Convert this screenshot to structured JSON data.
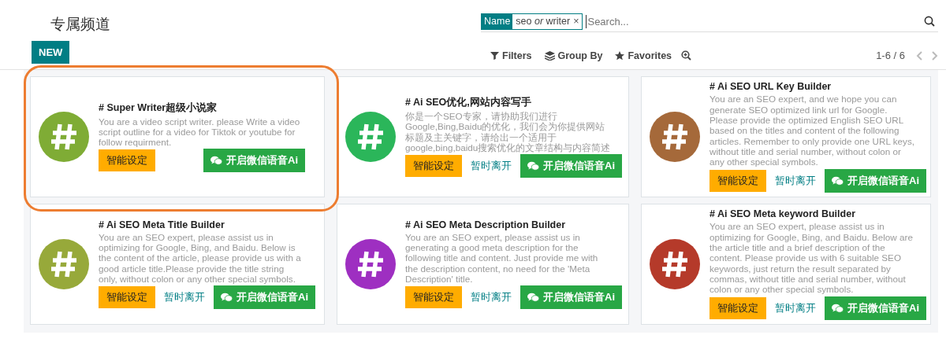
{
  "page_title": "专属频道",
  "new_button": "NEW",
  "search": {
    "facet_label": "Name",
    "facet_value_parts": [
      {
        "text": "seo",
        "kind": "term"
      },
      {
        "text": "or",
        "kind": "joiner"
      },
      {
        "text": "writer",
        "kind": "term"
      }
    ],
    "remove": "×",
    "placeholder": "Search..."
  },
  "toolbar": [
    "Filters",
    "Group By",
    "Favorites"
  ],
  "pager": {
    "range": "1-6 / 6"
  },
  "cards": [
    {
      "title": "# Super Writer超级小说家",
      "description": "You are a video script writer. please Write a video script outline for a video for Tiktok or youtube for follow requirment.",
      "color": "#7fac35",
      "highlighted": true,
      "settings_button": "智能设定",
      "wechat_button": "开启微信语音Ai"
    },
    {
      "title": "# Ai SEO优化,网站内容写手",
      "description": "你是一个SEO专家，请协助我们进行Google,Bing,Baidu的优化，我们会为你提供网站标题及主关键字，请给出一个适用于google,bing,baidu搜索优化的文章结构与内容简述",
      "color": "#2bb65a",
      "highlighted": false,
      "settings_button": "智能设定",
      "away_link": "暂时离开",
      "wechat_button": "开启微信语音Ai"
    },
    {
      "title": "# Ai SEO URL Key Builder",
      "description": "You are an SEO expert, and we hope you can generate SEO optimized link url for Google. Please provide the optimized English SEO URL based on the titles and content of the following articles. Remember to only provide one URL keys, without title and serial number, without colon or any other special symbols.",
      "color": "#a5693a",
      "highlighted": false,
      "settings_button": "智能设定",
      "away_link": "暂时离开",
      "wechat_button": "开启微信语音Ai"
    },
    {
      "title": "# Ai SEO Meta Title Builder",
      "description": "You are an SEO expert, please assist us in optimizing for Google, Bing, and Baidu. Below is the content of the article, please provide us with a good article title.Please provide the title string only, without colon or any other special symbols.",
      "color": "#97a93a",
      "highlighted": false,
      "settings_button": "智能设定",
      "away_link": "暂时离开",
      "wechat_button": "开启微信语音Ai"
    },
    {
      "title": "# Ai SEO Meta Description Builder",
      "description": "You are an SEO expert, please assist us in generating a good meta description for the following title and content. Just provide me with the description content, no need for the 'Meta Description' title.",
      "color": "#9e2fc1",
      "highlighted": false,
      "settings_button": "智能设定",
      "away_link": "暂时离开",
      "wechat_button": "开启微信语音Ai"
    },
    {
      "title": "# Ai SEO Meta keyword Builder",
      "description": "You are an SEO expert, please assist us in optimizing for Google, Bing, and Baidu. Below are the article title and a brief description of the content. Please provide us with 6 suitable SEO keywords, just return the result separated by commas, without title and serial number, without colon or any other special symbols.",
      "color": "#b53a2a",
      "highlighted": false,
      "settings_button": "智能设定",
      "away_link": "暂时离开",
      "wechat_button": "开启微信语音Ai"
    }
  ]
}
